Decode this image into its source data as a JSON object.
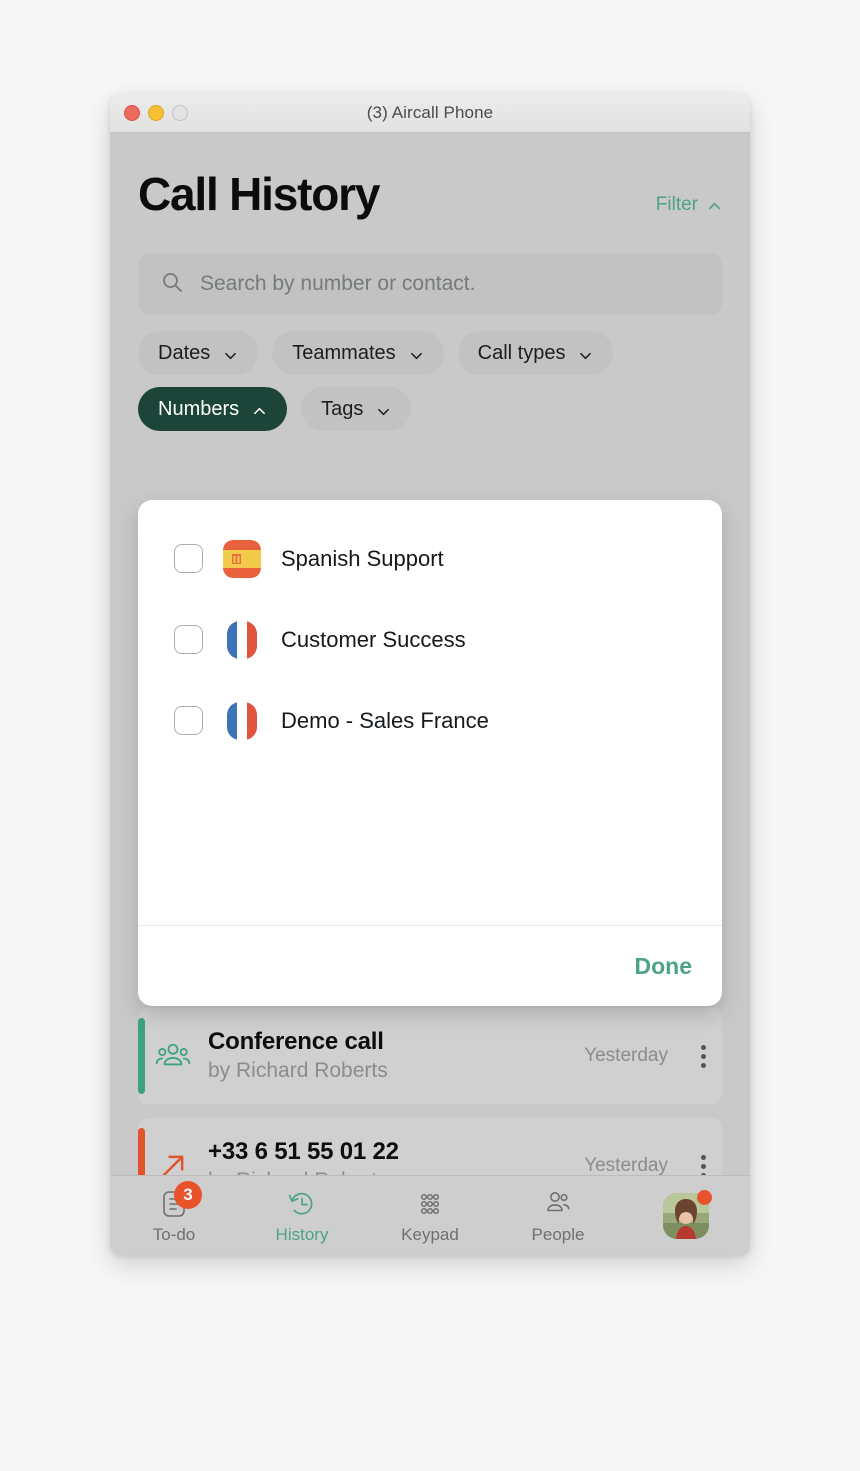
{
  "window": {
    "title": "(3) Aircall Phone",
    "traffic_lights": [
      "close",
      "minimize",
      "zoom"
    ]
  },
  "header": {
    "page_title": "Call History",
    "filter_label": "Filter",
    "filter_chevron": "chevron-up"
  },
  "search": {
    "placeholder": "Search by number or contact.",
    "value": "",
    "icon": "search-icon"
  },
  "filters": {
    "row1": [
      {
        "label": "Dates",
        "active": false,
        "chevron": "chevron-down"
      },
      {
        "label": "Teammates",
        "active": false,
        "chevron": "chevron-down"
      },
      {
        "label": "Call types",
        "active": false,
        "chevron": "chevron-down"
      }
    ],
    "row2": [
      {
        "label": "Numbers",
        "active": true,
        "chevron": "chevron-up"
      },
      {
        "label": "Tags",
        "active": false,
        "chevron": "chevron-down"
      }
    ]
  },
  "numbers_dropdown": {
    "open": true,
    "options": [
      {
        "label": "Spanish Support",
        "flag": "flag-spain",
        "checked": false
      },
      {
        "label": "Customer Success",
        "flag": "flag-france",
        "checked": false
      },
      {
        "label": "Demo - Sales France",
        "flag": "flag-france",
        "checked": false
      }
    ],
    "done_label": "Done"
  },
  "call_list": [
    {
      "title": "Conference call",
      "subtitle": "by Richard Roberts",
      "time": "Yesterday",
      "icon": "conference-group-icon",
      "stripe_color": "#3da47e"
    },
    {
      "title": "+33 6 51 55 01 22",
      "subtitle": "by Richard Roberts",
      "time": "Yesterday",
      "icon": "outgoing-call-arrow-icon",
      "stripe_color": "#e0552c"
    }
  ],
  "bottom_nav": {
    "items": [
      {
        "label": "To-do",
        "icon": "todo-list-icon",
        "active": false,
        "badge": "3"
      },
      {
        "label": "History",
        "icon": "history-clock-icon",
        "active": true,
        "badge": ""
      },
      {
        "label": "Keypad",
        "icon": "keypad-grid-icon",
        "active": false,
        "badge": ""
      },
      {
        "label": "People",
        "icon": "people-icon",
        "active": false,
        "badge": ""
      }
    ],
    "avatar": {
      "name": "user-avatar",
      "status_dot": true
    }
  },
  "colors": {
    "accent_green": "#4da387",
    "dark_green": "#1c4438",
    "orange": "#e8532c",
    "window_bg": "#c9c9c9",
    "page_bg": "#f7f7f7"
  }
}
